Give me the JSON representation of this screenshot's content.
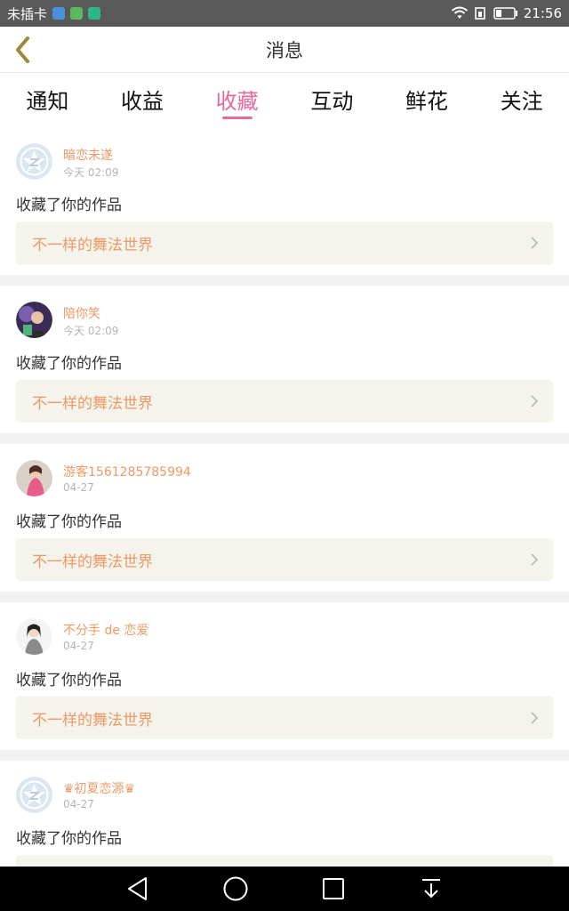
{
  "status_bar": {
    "carrier": "未插卡",
    "time": "21:56",
    "app_icons": [
      {
        "name": "app-icon-1",
        "color": "#4a90d9"
      },
      {
        "name": "app-icon-2",
        "color": "#5cb85c"
      },
      {
        "name": "app-icon-3",
        "color": "#2fb58a"
      }
    ]
  },
  "header": {
    "title": "消息"
  },
  "tabs": [
    {
      "label": "通知",
      "active": false
    },
    {
      "label": "收益",
      "active": false
    },
    {
      "label": "收藏",
      "active": true
    },
    {
      "label": "互动",
      "active": false
    },
    {
      "label": "鲜花",
      "active": false
    },
    {
      "label": "关注",
      "active": false
    }
  ],
  "messages": [
    {
      "username": "暗恋未遂",
      "time": "今天 02:09",
      "action": "收藏了你的作品",
      "work": "不一样的舞法世界",
      "avatar": "default-avatar"
    },
    {
      "username": "陪你笑",
      "time": "今天 02:09",
      "action": "收藏了你的作品",
      "work": "不一样的舞法世界",
      "avatar": "photo-avatar"
    },
    {
      "username": "游客1561285785994",
      "time": "04-27",
      "action": "收藏了你的作品",
      "work": "不一样的舞法世界",
      "avatar": "photo-avatar"
    },
    {
      "username": "不分手 de 恋爱",
      "time": "04-27",
      "action": "收藏了你的作品",
      "work": "不一样的舞法世界",
      "avatar": "photo-avatar"
    },
    {
      "username": "♛初夏恋源♛",
      "time": "04-27",
      "action": "收藏了你的作品",
      "work": "",
      "avatar": "default-avatar"
    }
  ],
  "colors": {
    "accent": "#e8679d",
    "username": "#ee9966",
    "card_bg": "#f4f3ec",
    "status_bar": "#595959"
  }
}
